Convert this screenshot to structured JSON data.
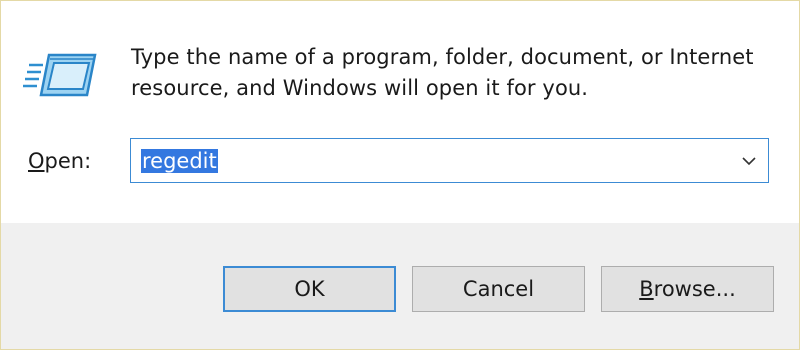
{
  "dialog": {
    "description": "Type the name of a program, folder, document, or Internet resource, and Windows will open it for you.",
    "open_label_underlined": "O",
    "open_label_rest": "pen:",
    "input_value": "regedit",
    "icon": "run-icon",
    "dropdown_icon": "chevron-down-icon"
  },
  "buttons": {
    "ok": "OK",
    "cancel": "Cancel",
    "browse_underlined": "B",
    "browse_rest": "rowse..."
  },
  "colors": {
    "focus_border": "#3c8bd4",
    "selection": "#3478e0",
    "footer_bg": "#f0f0f0"
  }
}
